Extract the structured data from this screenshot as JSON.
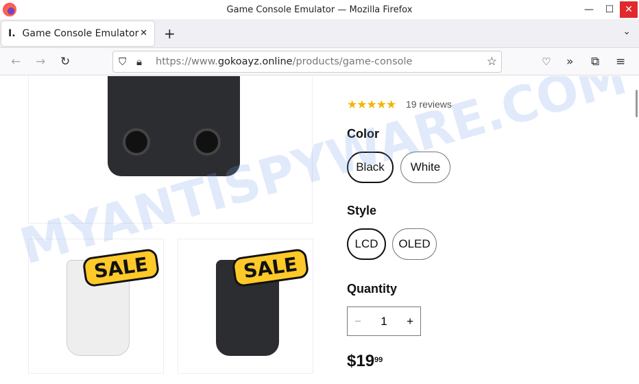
{
  "window": {
    "title": "Game Console Emulator — Mozilla Firefox"
  },
  "tab": {
    "favicon": "I.",
    "label": "Game Console Emulator"
  },
  "url": {
    "prefix": "https://www.",
    "domain": "gokoayz.online",
    "path": "/products/game-console"
  },
  "product": {
    "rating": 5,
    "stars": "★★★★★",
    "reviews": "19 reviews",
    "color_label": "Color",
    "colors": [
      "Black",
      "White"
    ],
    "selected_color": "Black",
    "style_label": "Style",
    "styles": [
      "LCD",
      "OLED"
    ],
    "selected_style": "LCD",
    "quantity_label": "Quantity",
    "quantity": "1",
    "price_main": "$19",
    "price_cents": "99",
    "sale_badge": "SALE"
  },
  "watermark": "MYANTISPYWARE.COM",
  "colors": {
    "star": "#f5b400",
    "close": "#e0282e",
    "sale": "#ffc928"
  }
}
